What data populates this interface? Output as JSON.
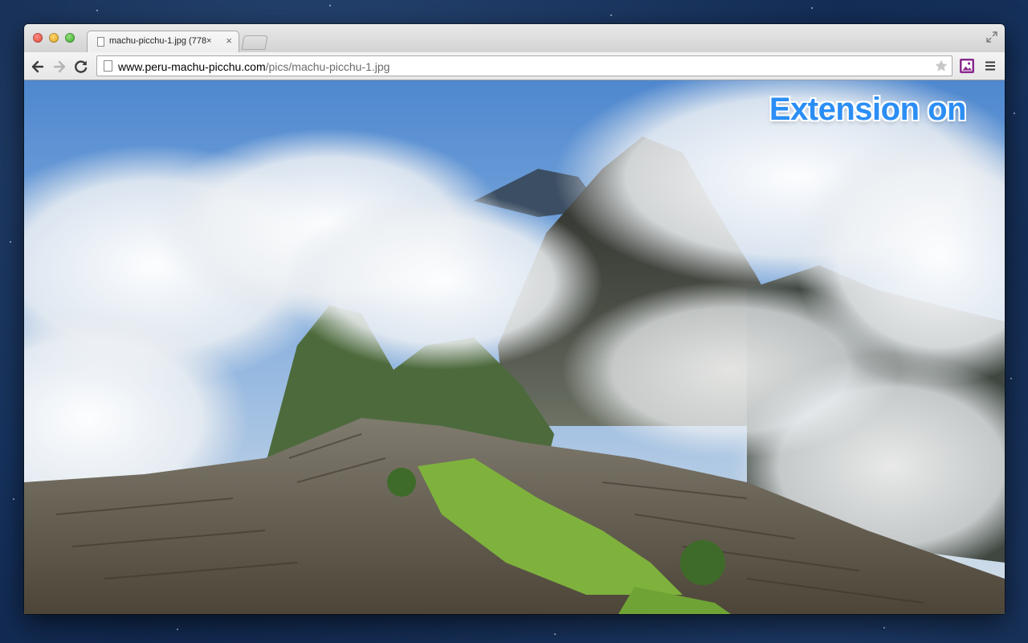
{
  "window": {
    "tab": {
      "title": "machu-picchu-1.jpg (778×",
      "close_glyph": "×"
    },
    "toolbar": {
      "back_icon": "back-arrow-icon",
      "forward_icon": "forward-arrow-icon",
      "reload_icon": "reload-icon",
      "url_domain": "www.peru-machu-picchu.com",
      "url_path": "/pics/machu-picchu-1.jpg",
      "bookmark_icon": "star-icon",
      "extension_icon": "image-extension-icon",
      "menu_icon": "hamburger-menu-icon"
    }
  },
  "content": {
    "overlay_label": "Extension on",
    "image_subject": "photo"
  },
  "colors": {
    "overlay_text": "#2b8ef5",
    "extension_icon": "#8b2a8e",
    "desktop_background": "#16325e"
  }
}
